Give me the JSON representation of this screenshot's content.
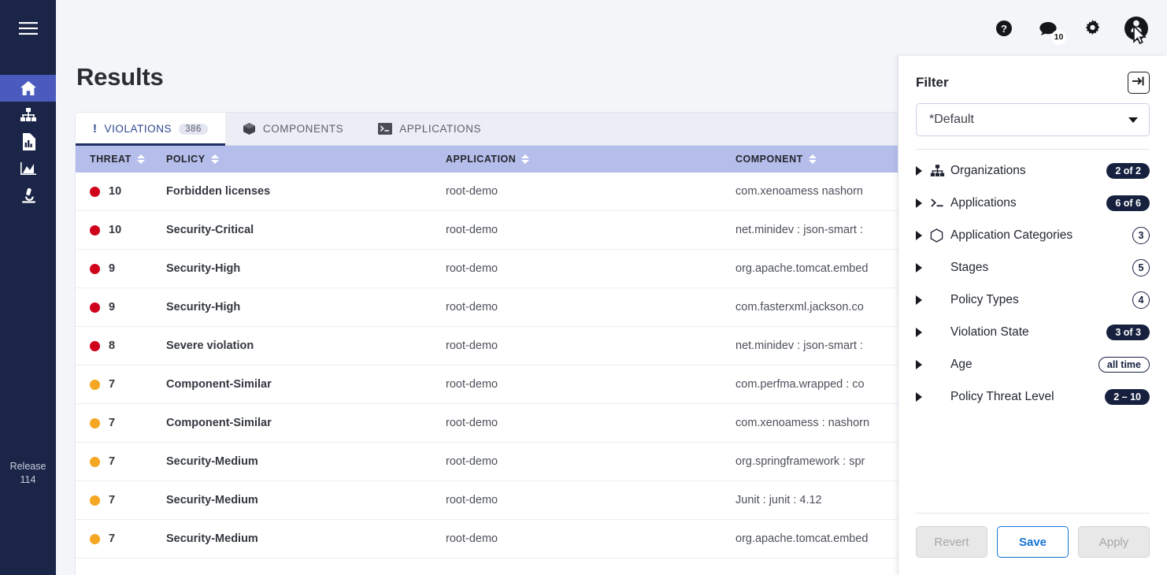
{
  "sidebar": {
    "menu_icon": "hamburger-icon",
    "items": [
      {
        "name": "home",
        "icon": "home-icon",
        "active": true
      },
      {
        "name": "organizations",
        "icon": "org-chart-icon",
        "active": false
      },
      {
        "name": "reports",
        "icon": "report-document-icon",
        "active": false
      },
      {
        "name": "dashboard",
        "icon": "area-chart-icon",
        "active": false
      },
      {
        "name": "research",
        "icon": "microscope-icon",
        "active": false
      }
    ],
    "release_label": "Release",
    "release_version": "114"
  },
  "topbar": {
    "help_icon": "help-circle-icon",
    "notifications_icon": "feedback-icon",
    "notifications_count": "10",
    "settings_icon": "gear-icon",
    "avatar_icon": "user-avatar-icon"
  },
  "page": {
    "title": "Results",
    "export_icon": "export-icon"
  },
  "tabs": [
    {
      "label": "VIOLATIONS",
      "icon": "exclamation-icon",
      "count": "386",
      "active": true
    },
    {
      "label": "COMPONENTS",
      "icon": "cube-icon",
      "count": "",
      "active": false
    },
    {
      "label": "APPLICATIONS",
      "icon": "terminal-icon",
      "count": "",
      "active": false
    }
  ],
  "table": {
    "columns": [
      {
        "key": "threat",
        "label": "THREAT"
      },
      {
        "key": "policy",
        "label": "POLICY"
      },
      {
        "key": "application",
        "label": "APPLICATION"
      },
      {
        "key": "component",
        "label": "COMPONENT"
      }
    ],
    "rows": [
      {
        "threat": "10",
        "severity_color": "#d0021b",
        "policy": "Forbidden licenses",
        "application": "root-demo",
        "component": "com.xenoamess nashorn"
      },
      {
        "threat": "10",
        "severity_color": "#d0021b",
        "policy": "Security-Critical",
        "application": "root-demo",
        "component": "net.minidev : json-smart :"
      },
      {
        "threat": "9",
        "severity_color": "#d0021b",
        "policy": "Security-High",
        "application": "root-demo",
        "component": "org.apache.tomcat.embed"
      },
      {
        "threat": "9",
        "severity_color": "#d0021b",
        "policy": "Security-High",
        "application": "root-demo",
        "component": "com.fasterxml.jackson.co"
      },
      {
        "threat": "8",
        "severity_color": "#d0021b",
        "policy": "Severe violation",
        "application": "root-demo",
        "component": "net.minidev : json-smart :"
      },
      {
        "threat": "7",
        "severity_color": "#f5a623",
        "policy": "Component-Similar",
        "application": "root-demo",
        "component": "com.perfma.wrapped : co"
      },
      {
        "threat": "7",
        "severity_color": "#f5a623",
        "policy": "Component-Similar",
        "application": "root-demo",
        "component": "com.xenoamess : nashorn"
      },
      {
        "threat": "7",
        "severity_color": "#f5a623",
        "policy": "Security-Medium",
        "application": "root-demo",
        "component": "org.springframework : spr"
      },
      {
        "threat": "7",
        "severity_color": "#f5a623",
        "policy": "Security-Medium",
        "application": "root-demo",
        "component": "Junit : junit : 4.12"
      },
      {
        "threat": "7",
        "severity_color": "#f5a623",
        "policy": "Security-Medium",
        "application": "root-demo",
        "component": "org.apache.tomcat.embed"
      }
    ]
  },
  "filter_panel": {
    "title": "Filter",
    "collapse_icon": "collapse-panel-right-icon",
    "preset_value": "*Default",
    "groups": [
      {
        "label": "Organizations",
        "icon": "org-chart-icon",
        "badge": "2 of 2",
        "badge_style": "solid"
      },
      {
        "label": "Applications",
        "icon": "terminal-icon",
        "badge": "6 of 6",
        "badge_style": "solid"
      },
      {
        "label": "Application Categories",
        "icon": "hexagon-icon",
        "badge": "3",
        "badge_style": "circle"
      },
      {
        "label": "Stages",
        "icon": "",
        "badge": "5",
        "badge_style": "circle"
      },
      {
        "label": "Policy Types",
        "icon": "",
        "badge": "4",
        "badge_style": "circle"
      },
      {
        "label": "Violation State",
        "icon": "",
        "badge": "3 of 3",
        "badge_style": "solid"
      },
      {
        "label": "Age",
        "icon": "",
        "badge": "all time",
        "badge_style": "outline"
      },
      {
        "label": "Policy Threat Level",
        "icon": "",
        "badge": "2 – 10",
        "badge_style": "solid"
      }
    ],
    "buttons": [
      {
        "label": "Revert",
        "state": "disabled"
      },
      {
        "label": "Save",
        "state": "primary"
      },
      {
        "label": "Apply",
        "state": "disabled"
      }
    ]
  },
  "colors": {
    "sidebar_bg": "#1b2547",
    "sidebar_active": "#4a5bbd",
    "table_header_bg": "#b5bdea",
    "accent_blue": "#1673d4",
    "badge_navy": "#17213f",
    "severity_critical": "#d0021b",
    "severity_medium": "#f5a623"
  }
}
